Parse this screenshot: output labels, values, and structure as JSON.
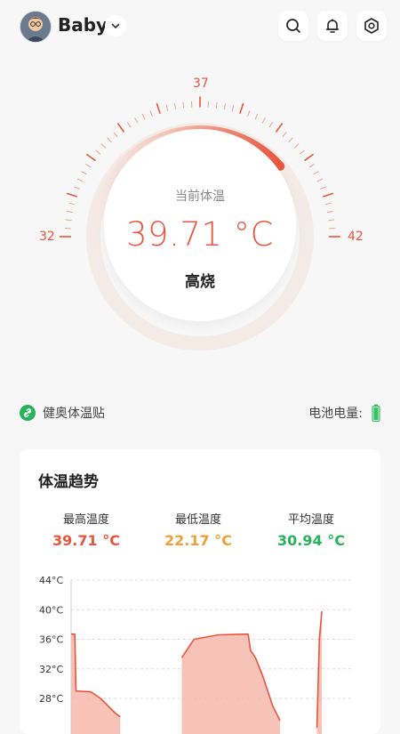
{
  "header": {
    "user_name": "Baby",
    "icons": [
      "avatar",
      "chevron-down-icon",
      "search-icon",
      "bell-icon",
      "settings-icon"
    ]
  },
  "gauge": {
    "scale_min": "32",
    "scale_mid": "37",
    "scale_max": "42",
    "current_label": "当前体温",
    "current_value": "39.71 °C",
    "status": "高烧",
    "level": 0.771
  },
  "device": {
    "name": "健奥体温贴",
    "battery_label": "电池电量:",
    "link_icon_color": "#27b35a",
    "battery_color": "#3ac05e"
  },
  "trend": {
    "title": "体温趋势",
    "stats": [
      {
        "label": "最高温度",
        "value": "39.71 °C",
        "color": "#e8563f"
      },
      {
        "label": "最低温度",
        "value": "22.17 °C",
        "color": "#f0a136"
      },
      {
        "label": "平均温度",
        "value": "30.94 °C",
        "color": "#27b35a"
      }
    ]
  },
  "chart_data": {
    "type": "area",
    "title": "",
    "xlabel": "",
    "ylabel": "",
    "ylim": [
      24,
      44
    ],
    "y_ticks": [
      "44°C",
      "40°C",
      "36°C",
      "32°C",
      "28°C"
    ],
    "y_tick_values": [
      44,
      40,
      36,
      32,
      28
    ],
    "grid": true,
    "series": [
      {
        "color": "#e8563f",
        "segments": [
          [
            [
              0,
              36.7
            ],
            [
              1.5,
              36.7
            ],
            [
              2,
              29.0
            ],
            [
              8,
              28.9
            ],
            [
              12,
              28.0
            ],
            [
              18,
              26.0
            ],
            [
              20,
              25.5
            ]
          ],
          [
            [
              45,
              33.5
            ],
            [
              50,
              36.0
            ],
            [
              60,
              36.6
            ],
            [
              72,
              36.7
            ],
            [
              73,
              34.5
            ],
            [
              75,
              33.5
            ],
            [
              78,
              31.0
            ],
            [
              82,
              27.0
            ],
            [
              85,
              25.0
            ]
          ],
          [
            [
              100,
              24.0
            ],
            [
              101,
              36.0
            ],
            [
              102,
              39.8
            ]
          ]
        ]
      }
    ],
    "x_range": [
      0,
      115
    ]
  }
}
